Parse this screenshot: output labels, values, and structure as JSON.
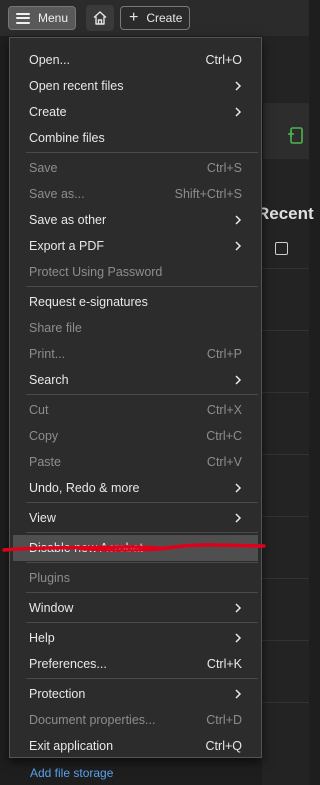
{
  "toolbar": {
    "menu_label": "Menu",
    "create_label": "Create"
  },
  "background": {
    "section_title": "Recent",
    "bottom_link": "Add file storage"
  },
  "colors": {
    "accent_green": "#4fb34f",
    "link_blue": "#5aa3f0",
    "annotation_red": "#e0001a"
  },
  "menu": {
    "items": [
      {
        "label": "Open...",
        "shortcut": "Ctrl+O",
        "submenu": false,
        "enabled": true
      },
      {
        "label": "Open recent files",
        "shortcut": "",
        "submenu": true,
        "enabled": true
      },
      {
        "label": "Create",
        "shortcut": "",
        "submenu": true,
        "enabled": true
      },
      {
        "label": "Combine files",
        "shortcut": "",
        "submenu": false,
        "enabled": true
      },
      {
        "label": "Save",
        "shortcut": "Ctrl+S",
        "submenu": false,
        "enabled": false
      },
      {
        "label": "Save as...",
        "shortcut": "Shift+Ctrl+S",
        "submenu": false,
        "enabled": false
      },
      {
        "label": "Save as other",
        "shortcut": "",
        "submenu": true,
        "enabled": true
      },
      {
        "label": "Export a PDF",
        "shortcut": "",
        "submenu": true,
        "enabled": true
      },
      {
        "label": "Protect Using Password",
        "shortcut": "",
        "submenu": false,
        "enabled": false
      },
      {
        "label": "Request e-signatures",
        "shortcut": "",
        "submenu": false,
        "enabled": true
      },
      {
        "label": "Share file",
        "shortcut": "",
        "submenu": false,
        "enabled": false
      },
      {
        "label": "Print...",
        "shortcut": "Ctrl+P",
        "submenu": false,
        "enabled": false
      },
      {
        "label": "Search",
        "shortcut": "",
        "submenu": true,
        "enabled": true
      },
      {
        "label": "Cut",
        "shortcut": "Ctrl+X",
        "submenu": false,
        "enabled": false
      },
      {
        "label": "Copy",
        "shortcut": "Ctrl+C",
        "submenu": false,
        "enabled": false
      },
      {
        "label": "Paste",
        "shortcut": "Ctrl+V",
        "submenu": false,
        "enabled": false
      },
      {
        "label": "Undo, Redo & more",
        "shortcut": "",
        "submenu": true,
        "enabled": true
      },
      {
        "label": "View",
        "shortcut": "",
        "submenu": true,
        "enabled": true
      },
      {
        "label": "Disable new Acrobat",
        "shortcut": "",
        "submenu": false,
        "enabled": true,
        "highlighted": true
      },
      {
        "label": "Plugins",
        "shortcut": "",
        "submenu": false,
        "enabled": false
      },
      {
        "label": "Window",
        "shortcut": "",
        "submenu": true,
        "enabled": true
      },
      {
        "label": "Help",
        "shortcut": "",
        "submenu": true,
        "enabled": true
      },
      {
        "label": "Preferences...",
        "shortcut": "Ctrl+K",
        "submenu": false,
        "enabled": true
      },
      {
        "label": "Protection",
        "shortcut": "",
        "submenu": true,
        "enabled": true
      },
      {
        "label": "Document properties...",
        "shortcut": "Ctrl+D",
        "submenu": false,
        "enabled": false
      },
      {
        "label": "Exit application",
        "shortcut": "Ctrl+Q",
        "submenu": false,
        "enabled": true
      }
    ]
  }
}
